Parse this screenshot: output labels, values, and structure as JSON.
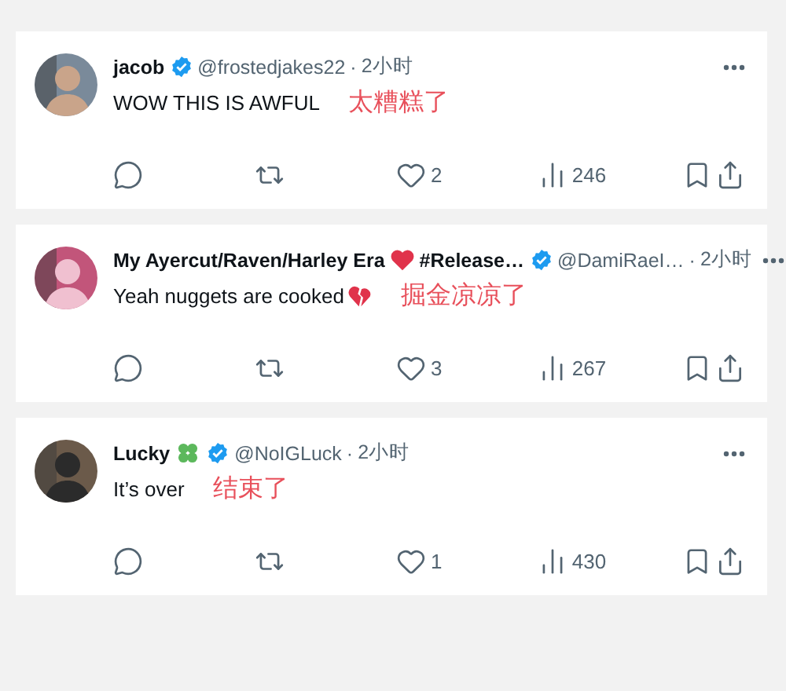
{
  "replies": [
    {
      "avatar": {
        "kind": "picture"
      },
      "name_parts": [
        {
          "kind": "text",
          "text": "jacob"
        }
      ],
      "verified": true,
      "handle": "@frostedjakes22",
      "separator": "·",
      "time": "2小时",
      "body_parts": [
        {
          "kind": "text",
          "text": "WOW THIS IS AWFUL"
        }
      ],
      "annotation": "太糟糕了",
      "actions": [
        {
          "kind": "reply"
        },
        {
          "kind": "repost"
        },
        {
          "kind": "like",
          "count": "2"
        },
        {
          "kind": "views",
          "count": "246"
        },
        {
          "kind": "bookmark"
        },
        {
          "kind": "share"
        }
      ]
    },
    {
      "avatar": {
        "kind": "picture"
      },
      "name_parts": [
        {
          "kind": "text",
          "text": "My Ayercut/Raven/Harley Era"
        },
        {
          "kind": "heart"
        },
        {
          "kind": "text",
          "text": "#Release…"
        }
      ],
      "verified": true,
      "handle": "@DamiRaeI…",
      "separator": "·",
      "time": "2小时",
      "body_parts": [
        {
          "kind": "text",
          "text": "Yeah nuggets are cooked"
        },
        {
          "kind": "broken-heart"
        }
      ],
      "annotation": "掘金凉凉了",
      "actions": [
        {
          "kind": "reply"
        },
        {
          "kind": "repost"
        },
        {
          "kind": "like",
          "count": "3"
        },
        {
          "kind": "views",
          "count": "267"
        },
        {
          "kind": "bookmark"
        },
        {
          "kind": "share"
        }
      ]
    },
    {
      "avatar": {
        "kind": "picture"
      },
      "name_parts": [
        {
          "kind": "text",
          "text": "Lucky"
        },
        {
          "kind": "clover"
        }
      ],
      "verified": true,
      "handle": "@NoIGLuck",
      "separator": "·",
      "time": "2小时",
      "body_parts": [
        {
          "kind": "text",
          "text": "It’s over"
        }
      ],
      "annotation": "结束了",
      "actions": [
        {
          "kind": "reply"
        },
        {
          "kind": "repost"
        },
        {
          "kind": "like",
          "count": "1"
        },
        {
          "kind": "views",
          "count": "430"
        },
        {
          "kind": "bookmark"
        },
        {
          "kind": "share"
        }
      ]
    }
  ]
}
